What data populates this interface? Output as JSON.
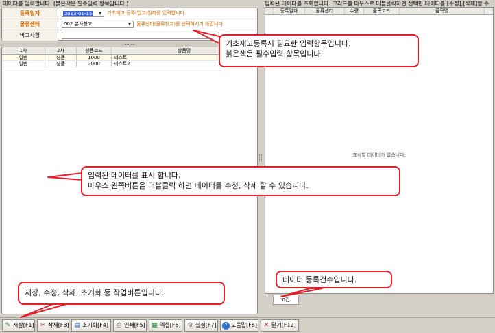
{
  "left_panel": {
    "hint": "데이터를 입력합니다. (붉은색은 필수입력 항목입니다.)",
    "form": {
      "date_label": "등록일자",
      "date_value": "2013-01-15",
      "date_note": "기초재고 등록(입고)일자를 입력합니다.",
      "center_label": "물류센터",
      "center_value": "002 본사창고",
      "center_note": "물류센터(물류창고)를 선택하시기 바랍니다.",
      "memo_label": "비고사항",
      "memo_value": ""
    },
    "grid": {
      "headers": [
        "1차",
        "2차",
        "상품코드",
        "상품명"
      ],
      "rows": [
        [
          "일반",
          "상품",
          "1000",
          "테스트"
        ],
        [
          "일반",
          "상품",
          "2000",
          "테스트2"
        ]
      ]
    }
  },
  "right_panel": {
    "hint": "입력된 데이터를 조회합니다. 그리드를 마우스로 더블클릭하면 선택한 데이터를 [수정],[삭제]할 수",
    "grid": {
      "headers": [
        "등록일자",
        "물류센터",
        "수량",
        "품목코드",
        "품목명"
      ],
      "empty_message": "표시할 데이터가 없습니다."
    },
    "count_tab": "0건"
  },
  "toolbar": {
    "buttons": [
      {
        "label": "저장[F1]",
        "icon": "save-icon"
      },
      {
        "label": "삭제[F3]",
        "icon": "delete-icon"
      },
      {
        "label": "초기화[F4]",
        "icon": "reset-icon"
      },
      {
        "label": "인쇄[F5]",
        "icon": "print-icon"
      },
      {
        "label": "엑셀[F6]",
        "icon": "excel-icon"
      },
      {
        "label": "설정[F7]",
        "icon": "settings-icon"
      },
      {
        "label": "도움말[F8]",
        "icon": "help-icon"
      },
      {
        "label": "닫기[F12]",
        "icon": "close-icon"
      }
    ]
  },
  "callouts": {
    "required_fields": [
      "기초재고등록시 필요한 입력항목입니다.",
      "붉은색은 필수입력 항목입니다."
    ],
    "data_display": [
      "입력된 데이터를 표시 합니다.",
      "마우스 왼쪽버튼을 더블클릭 하면 데이터를 수정, 삭제 할 수 있습니다."
    ],
    "count": [
      "데이터 등록건수입니다."
    ],
    "action_buttons": [
      "저장, 수정, 삭제, 초기화  등 작업버튼입니다."
    ]
  },
  "colors": {
    "required_label": "#d86a00",
    "callout_border": "#e0202a",
    "selection": "#3a63d9"
  }
}
